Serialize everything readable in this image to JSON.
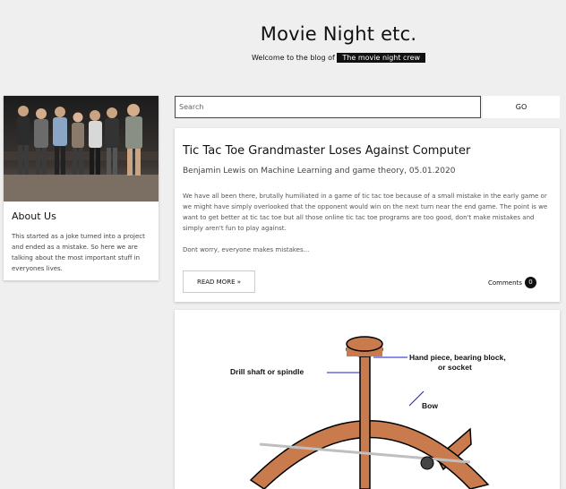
{
  "header": {
    "title": "Movie Night etc.",
    "subtitle_prefix": "Welcome to the blog of",
    "subtitle_highlight": "The movie night crew"
  },
  "sidebar": {
    "about_title": "About Us",
    "about_text": "This started as a joke turned into a project and ended as a mistake. So here we are talking about the most important stuff in everyones lives."
  },
  "search": {
    "placeholder": "Search",
    "go_label": "GO"
  },
  "post": {
    "title": "Tic Tac Toe Grandmaster Loses Against Computer",
    "author": "Benjamin Lewis",
    "meta_joiner": "on",
    "categories": "Machine Learning and game theory",
    "date": "05.01.2020",
    "body": "We have all been there, brutally humiliated in a game of tic tac toe because of a small mistake in the early game or we might have simply overlooked that the opponent would win on the next turn near the end game. The point is we want to get better at tic tac toe but all those online tic tac toe programs are too good, don't make mistakes and simply aren't fun to play against.",
    "teaser": "Dont worry, everyone makes mistakes...",
    "read_more_label": "READ MORE »",
    "comments_label": "Comments",
    "comments_count": "0"
  },
  "diagram": {
    "label_drill_shaft": "Drill shaft or spindle",
    "label_hand_piece_line1": "Hand piece, bearing block,",
    "label_hand_piece_line2": "or socket",
    "label_bow": "Bow",
    "wood_color": "#c97b4e",
    "line_color": "#1a1ad6"
  }
}
